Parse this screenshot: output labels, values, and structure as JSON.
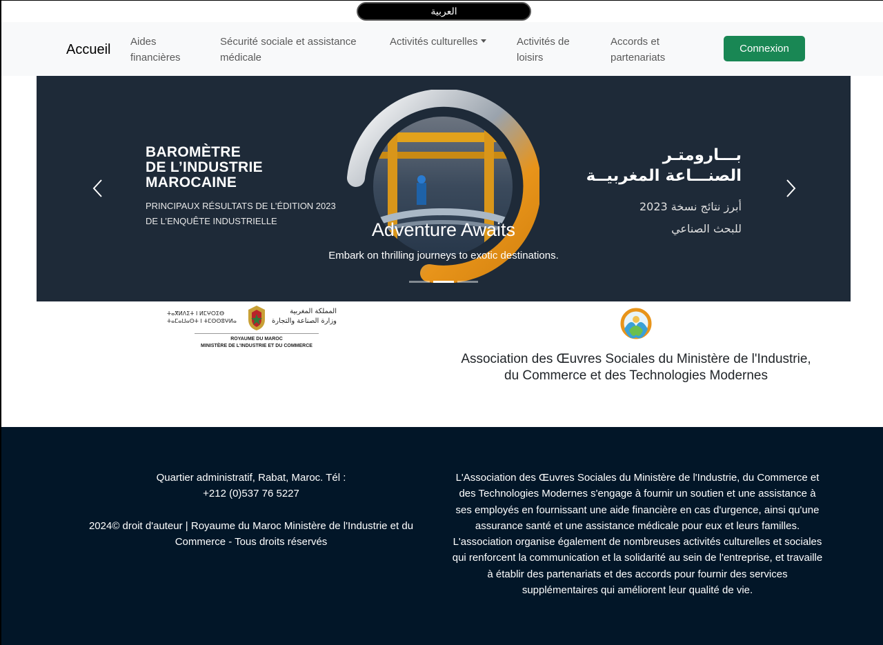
{
  "language_switch": {
    "label": "العربية"
  },
  "navbar": {
    "brand": "Accueil",
    "items": [
      {
        "label": "Aides financières"
      },
      {
        "label": "Sécurité sociale et assistance médicale"
      },
      {
        "label": "Activités culturelles"
      },
      {
        "label": "Activités de loisirs"
      },
      {
        "label": "Accords et partenariats"
      }
    ],
    "login_label": "Connexion",
    "login_color": "#198754"
  },
  "carousel": {
    "slide_title_fr": "BAROMÈTRE DE L’INDUSTRIE MAROCAINE",
    "slide_title_fr_lines": [
      "BAROMÈTRE",
      "DE L’INDUSTRIE",
      "MAROCAINE"
    ],
    "slide_sub_fr_lines": [
      "PRINCIPAUX RÉSULTATS DE L’ÉDITION 2023",
      "DE L’ENQUÊTE INDUSTRIELLE"
    ],
    "slide_title_ar_lines": [
      "بـــارومتـر",
      "الصنـــاعة المغربيــة"
    ],
    "slide_sub_ar_lines": [
      "أبرز نتائج نسخة 2023",
      "للبحث الصناعي"
    ],
    "caption_title": "Adventure Awaits",
    "caption_text": "Embark on thrilling journeys to exotic destinations.",
    "indicators": 3,
    "active_indicator": 2,
    "prev_icon": "chevron-left-icon",
    "next_icon": "chevron-right-icon",
    "background_color": "#1e2a38",
    "accent_color": "#e8941a"
  },
  "partners": {
    "ministry_ar_lines": [
      "المملكة المغربية",
      "وزارة الصناعة والتجارة"
    ],
    "ministry_tf_lines": [
      "ⵜⴰⴳⵍⴷⵉⵜ ⵏ ⵍⵎⵖⵔⵉⴱ",
      "ⵜⴰⵎⴰⵡⴰⵙⵜ ⵏ ⵜⵎⵙⵙⵓⵖⵍⴰ"
    ],
    "ministry_fr_lines": [
      "ROYAUME DU MAROC",
      "MINISTÈRE DE L'INDUSTRIE ET DU COMMERCE"
    ],
    "association_name_lines": [
      "Association des Œuvres Sociales du Ministère de l'Industrie,",
      "du Commerce et des Technologies Modernes"
    ]
  },
  "footer": {
    "address_lines": [
      "Quartier administratif, Rabat, Maroc. Tél :",
      "+212 (0)537 76 5227"
    ],
    "copyright": "2024© droit d'auteur | Royaume du Maroc Ministère de l'Industrie et du Commerce - Tous droits réservés",
    "about": "L'Association des Œuvres Sociales du Ministère de l'Industrie, du Commerce et des Technologies Modernes s'engage à fournir un soutien et une assistance à ses employés en fournissant une aide financière en cas d'urgence, ainsi qu'une assurance santé et une assistance médicale pour eux et leurs familles. L'association organise également de nombreuses activités culturelles et sociales qui renforcent la communication et la solidarité au sein de l'entreprise, et travaille à établir des partenariats et des accords pour fournir des services supplémentaires qui améliorent leur qualité de vie.",
    "background_color": "#021628"
  }
}
